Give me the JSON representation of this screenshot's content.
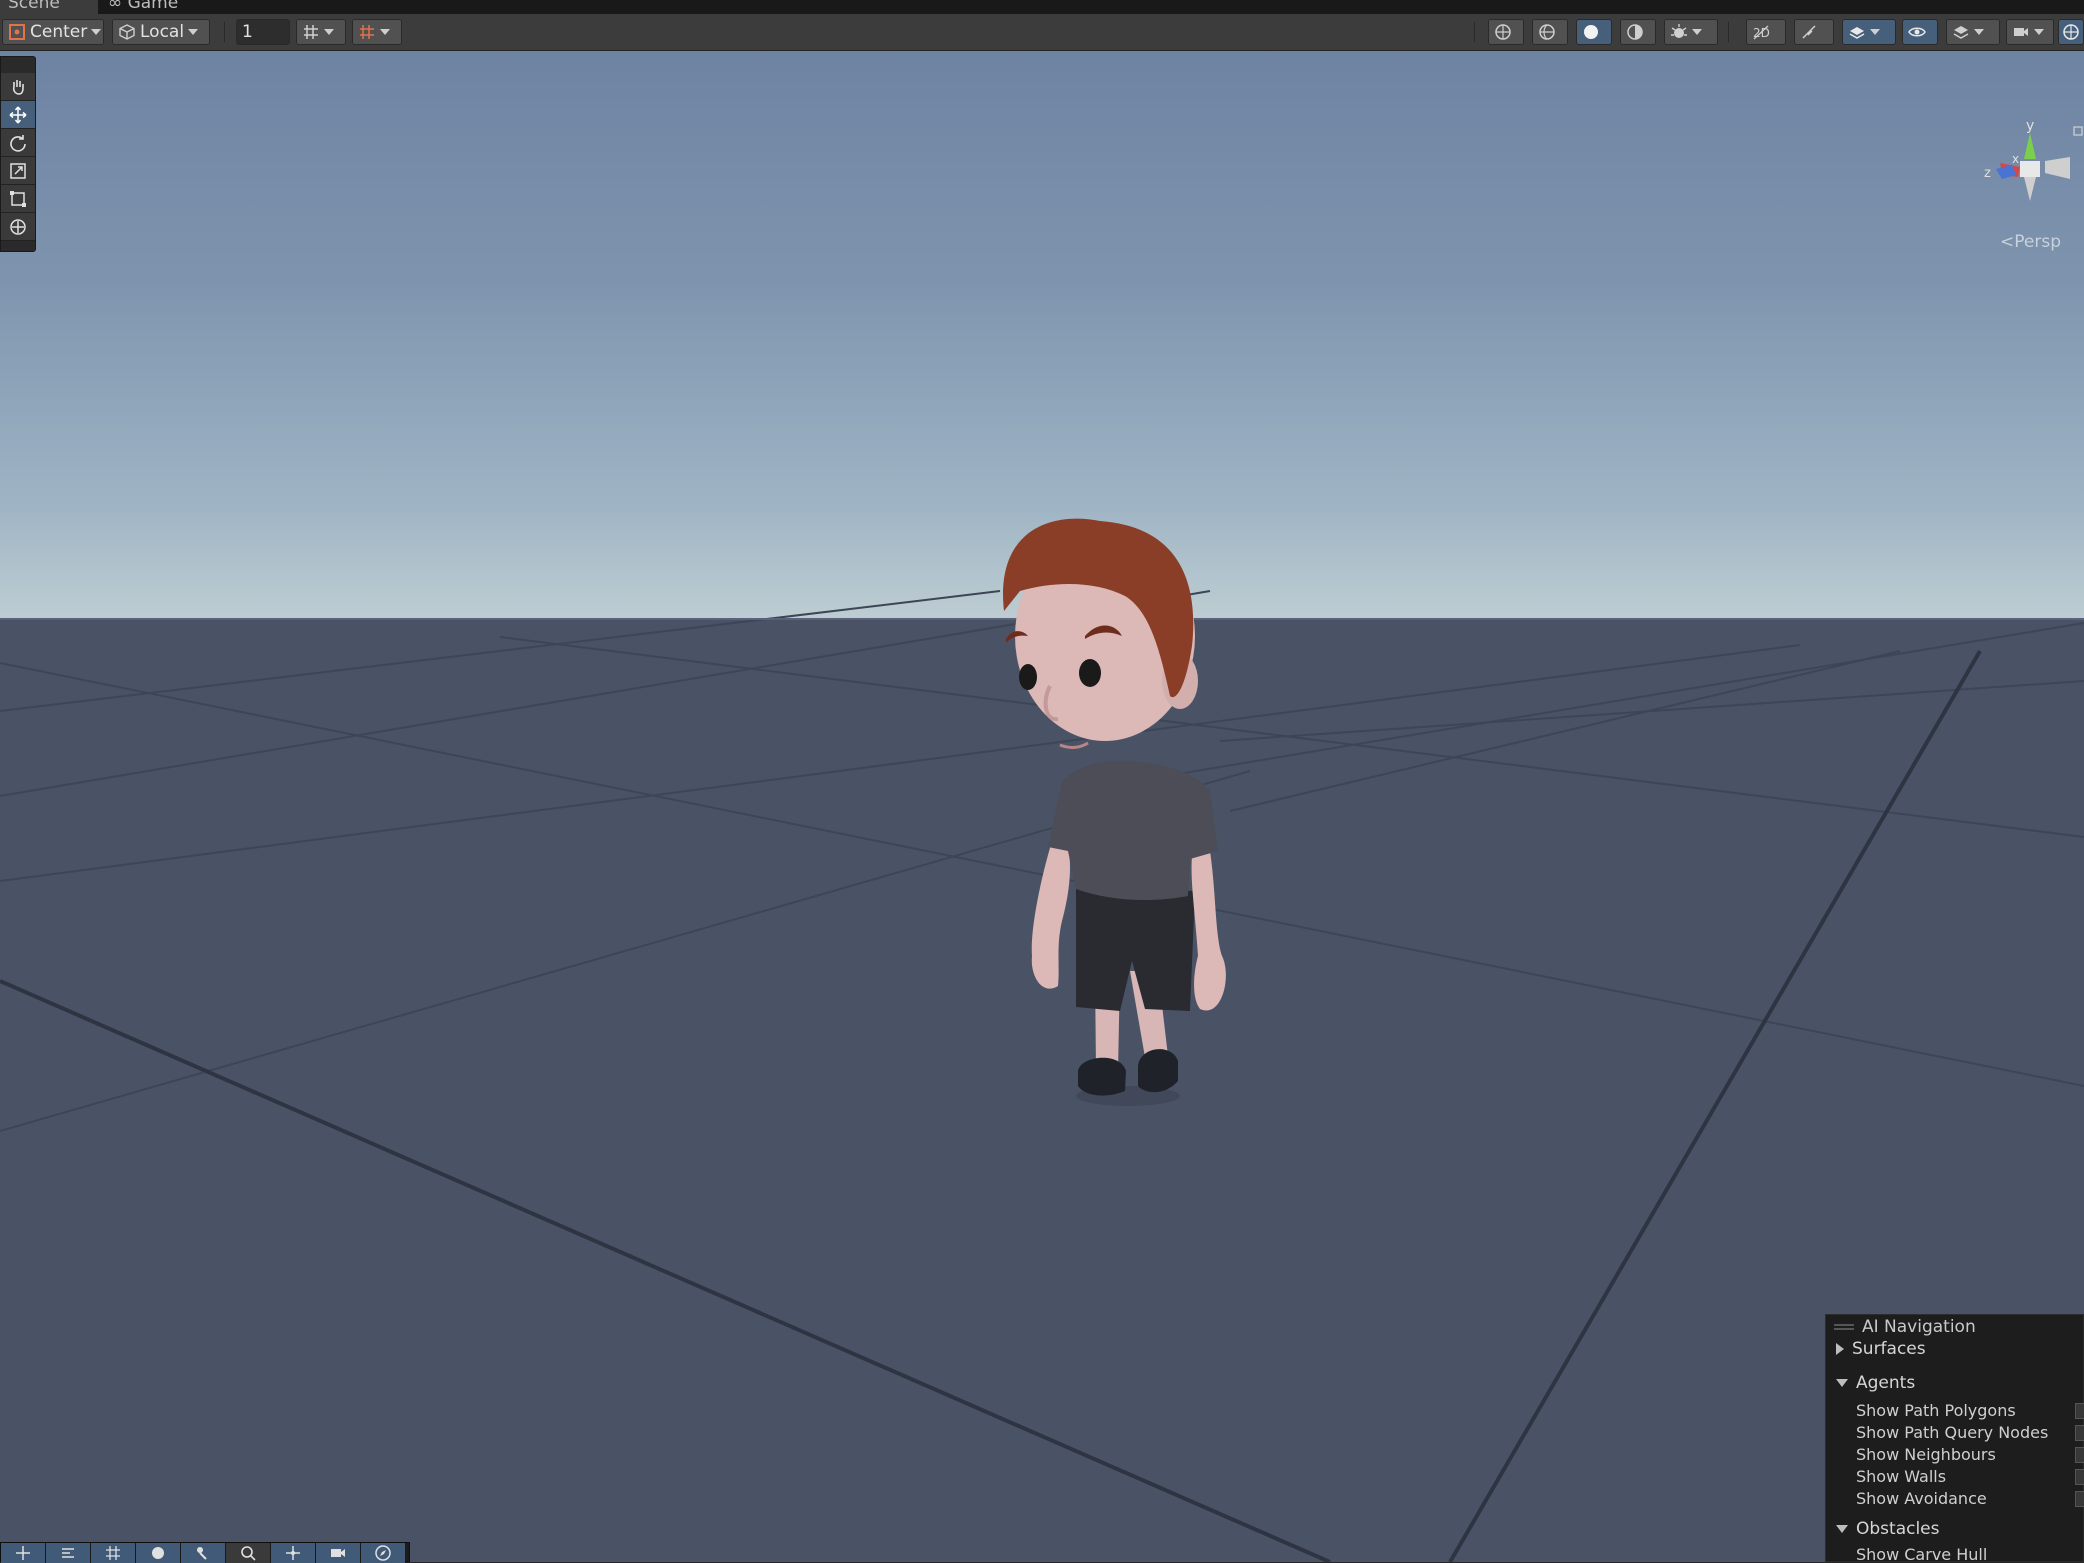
{
  "tabs": [
    {
      "label": "Scene",
      "active": true
    },
    {
      "label": "Game",
      "active": false
    }
  ],
  "toolbar": {
    "pivot_mode": "Center",
    "pivot_rotation": "Local",
    "grid_size": "1",
    "left_icons": [
      "grid-snap-icon",
      "increment-snap-icon"
    ],
    "right_icons": [
      "gizmo-orientation-icon",
      "wireframe-icon",
      "shaded-icon",
      "unlit-icon",
      "effects-icon",
      "audio-mute-icon",
      "2d-toggle-icon",
      "lighting-icon",
      "scene-visibility-icon",
      "layers-icon",
      "camera-icon",
      "orbit-icon"
    ]
  },
  "scene_tools": [
    "hand-tool-icon",
    "move-tool-icon",
    "rotate-tool-icon",
    "scale-tool-icon",
    "rect-tool-icon",
    "transform-tool-icon"
  ],
  "gizmo": {
    "projection": "Persp",
    "axes": [
      "y",
      "x",
      "z"
    ]
  },
  "ai_navigation": {
    "title": "AI Navigation",
    "sections": [
      {
        "label": "Surfaces",
        "expanded": false,
        "items": []
      },
      {
        "label": "Agents",
        "expanded": true,
        "items": [
          "Show Path Polygons",
          "Show Path Query Nodes",
          "Show Neighbours",
          "Show Walls",
          "Show Avoidance"
        ]
      },
      {
        "label": "Obstacles",
        "expanded": true,
        "items": [
          "Show Carve Hull"
        ]
      }
    ]
  },
  "bottom_tools": [
    "move-icon",
    "align-icon",
    "grid-icon",
    "sphere-icon",
    "bones-icon",
    "search-icon",
    "pivot-icon",
    "camera-icon",
    "compass-icon"
  ],
  "colors": {
    "sky_top": "#6d83a2",
    "horizon": "#bdcdd2",
    "ground": "#4a5366",
    "selected": "#46607c",
    "toolbar": "#3c3c3c"
  }
}
